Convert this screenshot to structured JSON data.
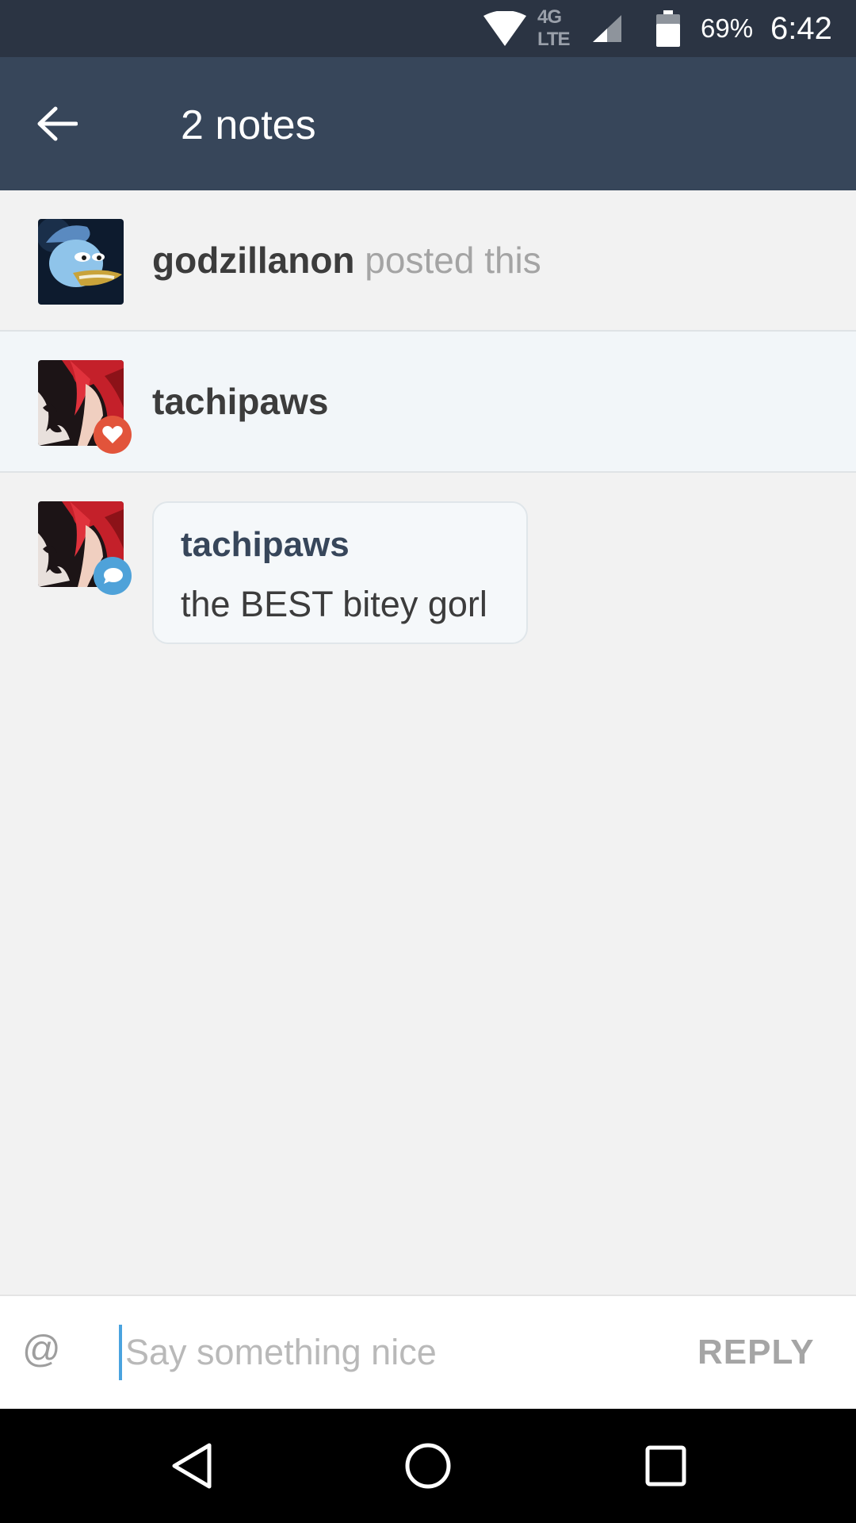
{
  "status_bar": {
    "network": "4G LTE",
    "battery_percent": "69%",
    "time": "6:42",
    "battery_level": 0.69,
    "icons": [
      "wifi-icon",
      "signal-icon",
      "battery-icon"
    ]
  },
  "app_bar": {
    "title": "2 notes",
    "back_icon": "arrow-left-icon"
  },
  "notes": [
    {
      "type": "posted",
      "username": "godzillanon",
      "action_text": "posted this",
      "avatar": "duck-avatar"
    },
    {
      "type": "like",
      "username": "tachipaws",
      "avatar": "red-hair-avatar",
      "badge_icon": "heart-icon"
    },
    {
      "type": "reply",
      "username": "tachipaws",
      "message": "the BEST bitey gorl",
      "avatar": "red-hair-avatar",
      "badge_icon": "speech-bubble-icon"
    }
  ],
  "reply_bar": {
    "mention_label": "@",
    "placeholder": "Say something nice",
    "value": "",
    "reply_label": "REPLY"
  },
  "nav_bar": {
    "icons": [
      "back-triangle-icon",
      "home-circle-icon",
      "recents-square-icon"
    ]
  },
  "colors": {
    "status_bar": "#2b3443",
    "app_bar": "#37465a",
    "like_badge": "#e2543b",
    "reply_badge": "#4fa2d9",
    "highlight_row": "#f2f6f9",
    "background": "#f2f2f2"
  }
}
